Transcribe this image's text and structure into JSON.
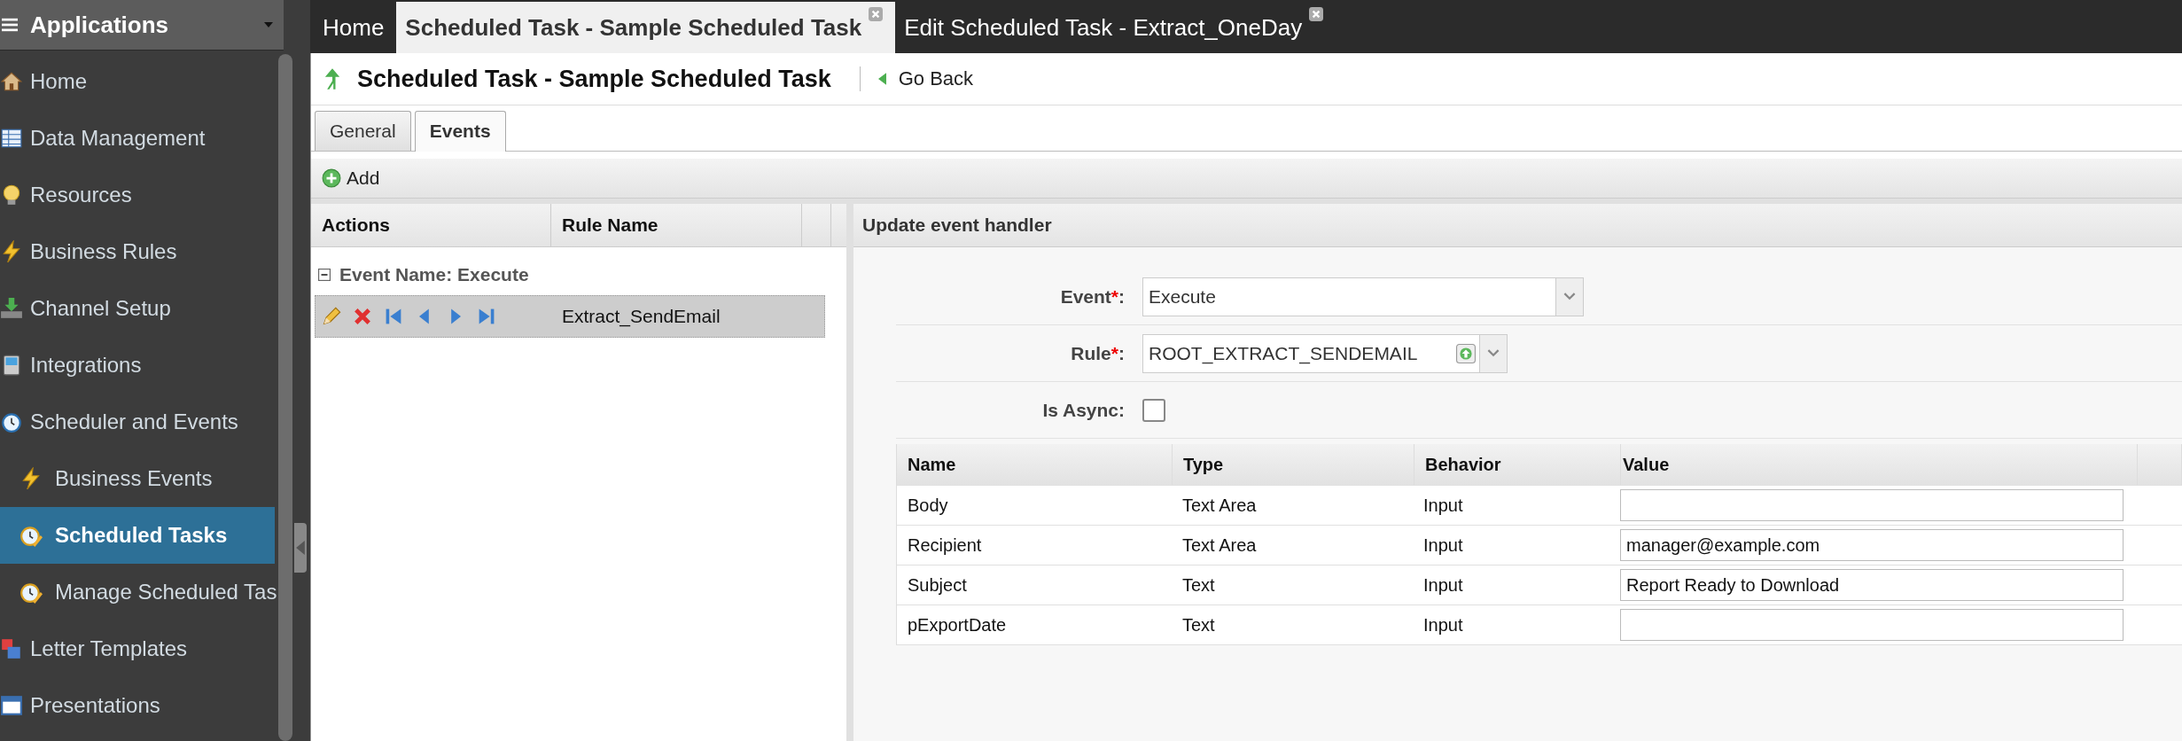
{
  "sidebar": {
    "title": "Applications",
    "items": [
      {
        "label": "Home",
        "selected": false
      },
      {
        "label": "Data Management",
        "selected": false
      },
      {
        "label": "Resources",
        "selected": false
      },
      {
        "label": "Business Rules",
        "selected": false
      },
      {
        "label": "Channel Setup",
        "selected": false
      },
      {
        "label": "Integrations",
        "selected": false
      },
      {
        "label": "Scheduler and Events",
        "selected": false,
        "children": [
          {
            "label": "Business Events",
            "selected": false
          },
          {
            "label": "Scheduled Tasks",
            "selected": true
          },
          {
            "label": "Manage Scheduled Tas",
            "selected": false
          }
        ]
      },
      {
        "label": "Letter Templates",
        "selected": false
      },
      {
        "label": "Presentations",
        "selected": false
      }
    ]
  },
  "tabs": [
    {
      "label": "Home",
      "selected": false,
      "closable": false
    },
    {
      "label": "Scheduled Task - Sample Scheduled Task",
      "selected": true,
      "closable": true
    },
    {
      "label": "Edit Scheduled Task - Extract_OneDay",
      "selected": false,
      "closable": true
    }
  ],
  "page": {
    "title": "Scheduled Task - Sample Scheduled Task",
    "back": "Go Back"
  },
  "subtabs": [
    {
      "label": "General",
      "selected": false
    },
    {
      "label": "Events",
      "selected": true
    }
  ],
  "toolbar": {
    "add": "Add"
  },
  "events_grid": {
    "columns": [
      "Actions",
      "Rule Name"
    ],
    "groups": [
      {
        "label": "Event Name: Execute",
        "expanded": true,
        "rows": [
          {
            "rule": "Extract_SendEmail",
            "selected": true
          }
        ]
      }
    ]
  },
  "handler": {
    "title": "Update event handler",
    "fields": [
      {
        "kind": "select",
        "label": "Event",
        "required_mark": "*",
        "colon": ":",
        "value": "Execute"
      },
      {
        "kind": "lookup",
        "label": "Rule",
        "required_mark": "*",
        "colon": ":",
        "value": "ROOT_EXTRACT_SENDEMAIL"
      },
      {
        "kind": "checkbox",
        "label": "Is Async:",
        "checked": false
      }
    ],
    "params": {
      "columns": [
        "Name",
        "Type",
        "Behavior",
        "Value"
      ],
      "rows": [
        {
          "name": "Body",
          "type": "Text Area",
          "behavior": "Input"
        },
        {
          "name": "Recipient",
          "type": "Text Area",
          "behavior": "Input",
          "value": "manager@example.com"
        },
        {
          "name": "Subject",
          "type": "Text",
          "behavior": "Input",
          "value": "Report Ready to Download"
        },
        {
          "name": "pExportDate",
          "type": "Text",
          "behavior": "Input"
        }
      ]
    }
  }
}
